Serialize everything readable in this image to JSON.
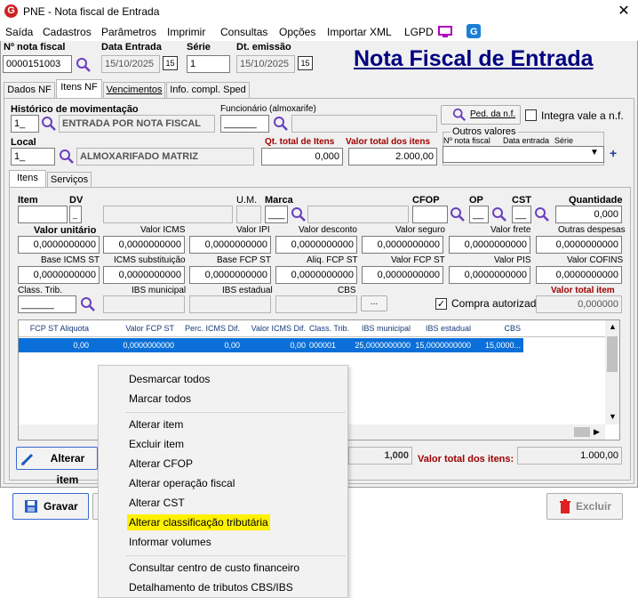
{
  "window": {
    "title": "PNE - Nota fiscal de Entrada",
    "logo": "G",
    "close": "✕"
  },
  "menu": [
    "Saída",
    "Cadastros",
    "Parâmetros",
    "Imprimir",
    "Consultas",
    "Opções",
    "Importar XML",
    "LGPD"
  ],
  "header": {
    "nota_label": "Nº nota fiscal",
    "nota_value": "0000151003",
    "data_entrada_label": "Data Entrada",
    "data_entrada_value": "15/10/2025",
    "serie_label": "Série",
    "serie_value": "1",
    "dt_emissao_label": "Dt. emissão",
    "dt_emissao_value": "15/10/2025",
    "cal_icon": "15",
    "page_title": "Nota Fiscal de Entrada"
  },
  "tabs": [
    "Dados NF",
    "Itens NF",
    "Vencimentos",
    "Info. compl. Sped"
  ],
  "itens": {
    "historico_label": "Histórico de movimentação",
    "historico_code": "1_",
    "historico_desc": "ENTRADA POR NOTA FISCAL",
    "funcionario_label": "Funcionário (almoxarife)",
    "funcionario_value": "______",
    "ped_button": "Ped. da n.f.",
    "integra_label": "Integra vale a n.f.",
    "local_label": "Local",
    "local_code": "1_",
    "local_desc": "ALMOXARIFADO MATRIZ",
    "qt_total_label": "Qt. total de Itens",
    "qt_total_value": "0,000",
    "valor_total_label": "Valor total dos itens",
    "valor_total_value": "2.000,00",
    "outros_label": "Outros valores",
    "outros_cols": [
      "Nº nota fiscal",
      "Data entrada",
      "Série"
    ],
    "plus": "+"
  },
  "subtabs": [
    "Itens",
    "Serviços"
  ],
  "item_form": {
    "row1": [
      "Item",
      "DV",
      "U.M.",
      "Marca",
      "CFOP",
      "OP",
      "CST",
      "Quantidade"
    ],
    "quantidade": "0,000",
    "row2_labels": [
      "Valor unitário",
      "Valor ICMS",
      "Valor IPI",
      "Valor desconto",
      "Valor seguro",
      "Valor frete",
      "Outras despesas"
    ],
    "row2_values": [
      "0,0000000000",
      "0,0000000000",
      "0,0000000000",
      "0,0000000000",
      "0,0000000000",
      "0,0000000000",
      "0,0000000000"
    ],
    "row3_labels": [
      "Base ICMS ST",
      "ICMS substituição",
      "Base FCP ST",
      "Aliq. FCP ST",
      "Valor FCP ST",
      "Valor PIS",
      "Valor COFINS"
    ],
    "row3_values": [
      "0,0000000000",
      "0,0000000000",
      "0,0000000000",
      "0,0000000000",
      "0,0000000000",
      "0,0000000000",
      "0,0000000000"
    ],
    "row4_labels": [
      "Class. Trib.",
      "IBS municipal",
      "IBS estadual",
      "CBS"
    ],
    "class_trib_value": "______",
    "ellipsis": "...",
    "compra_label": "Compra autorizada",
    "valor_total_item_label": "Valor total item",
    "valor_total_item_value": "0,000000"
  },
  "grid": {
    "columns": [
      "FCP ST Aliquota",
      "Valor FCP ST",
      "Perc. ICMS Dif.",
      "Valor ICMS Dif.",
      "Class. Trib.",
      "IBS municipal",
      "IBS estadual",
      "CBS"
    ],
    "row": [
      "0,00",
      "0,0000000000",
      "0,00",
      "0,00",
      "000001",
      "25,0000000000",
      "15,0000000000",
      "15,0000..."
    ]
  },
  "footer": {
    "alterar_item": "Alterar item",
    "total_qty": "1,000",
    "valor_total_label": "Valor total dos itens:",
    "valor_total_value": "1.000,00",
    "gravar": "Gravar",
    "excluir": "Excluir"
  },
  "context_menu": {
    "group1": [
      "Desmarcar todos",
      "Marcar todos"
    ],
    "group2": [
      "Alterar item",
      "Excluir item",
      "Alterar CFOP",
      "Alterar operação fiscal",
      "Alterar CST",
      "Alterar classificação tributária",
      "Informar volumes"
    ],
    "group3": [
      "Consultar centro de custo financeiro",
      "Detalhamento de tributos CBS/IBS"
    ]
  }
}
